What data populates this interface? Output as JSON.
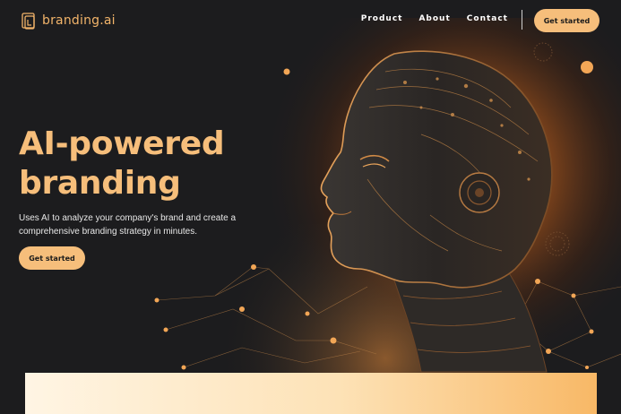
{
  "brand": {
    "name": "branding.ai",
    "logo_icon": "logo-mark-icon",
    "accent_color": "#f6be7b",
    "logo_color": "#f2b46a"
  },
  "nav": {
    "items": [
      {
        "label": "Product"
      },
      {
        "label": "About"
      },
      {
        "label": "Contact"
      }
    ],
    "cta_label": "Get started"
  },
  "hero": {
    "title_line1": "AI-powered",
    "title_line2": "branding",
    "subtitle": "Uses AI to analyze your company's brand and create a comprehensive branding strategy in minutes.",
    "cta_label": "Get started",
    "image": "ai-robot-head-profile-illustration"
  },
  "colors": {
    "background": "#1c1c1e",
    "button_text": "#1b1b1b",
    "panel_gradient": [
      "#fff5e4",
      "#fde2b6",
      "#f8b866"
    ]
  }
}
